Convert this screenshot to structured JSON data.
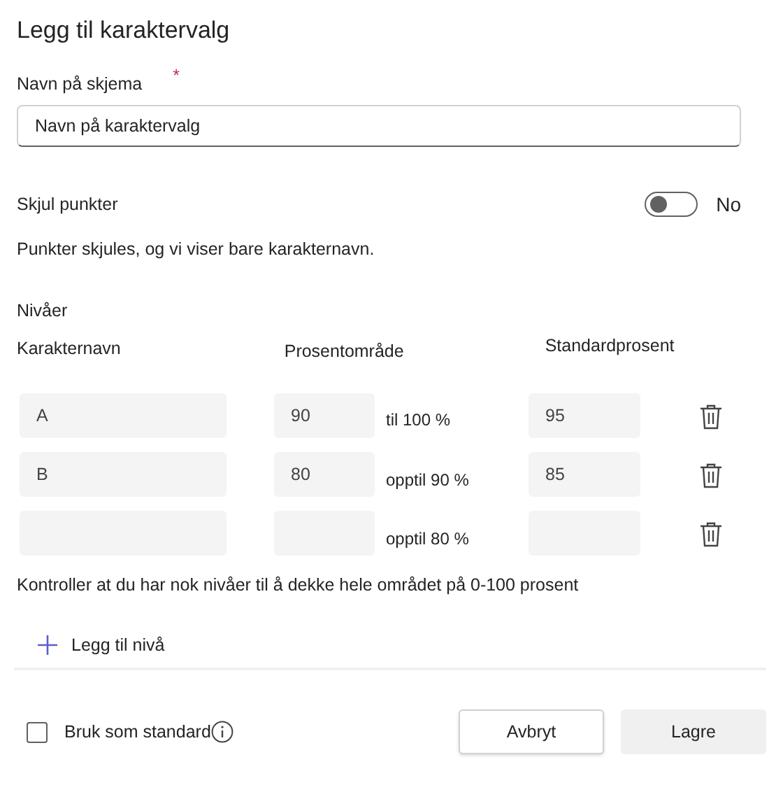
{
  "title": "Legg til karaktervalg",
  "schema_name": {
    "label": "Navn på skjema",
    "required_mark": "*",
    "value": "Navn på karaktervalg"
  },
  "hide_points": {
    "label": "Skjul punkter",
    "on": false,
    "state_text": "No",
    "description": "Punkter skjules, og vi viser bare karakternavn."
  },
  "levels": {
    "heading": "Nivåer",
    "columns": [
      "Karakternavn",
      "Prosentområde",
      "Standardprosent"
    ],
    "rows": [
      {
        "name": "A",
        "from": "90",
        "range_text": "til 100 %",
        "default": "95"
      },
      {
        "name": "B",
        "from": "80",
        "range_text": "opptil 90 %",
        "default": "85"
      },
      {
        "range_text": "opptil 80 %"
      }
    ],
    "note": "Kontroller at du har nok nivåer til å dekke hele området på 0-100 prosent",
    "add_label": "Legg til nivå"
  },
  "footer": {
    "default_checkbox": {
      "label": "Bruk som standard",
      "checked": false
    },
    "buttons": [
      {
        "label": "Avbryt",
        "kind": "secondary"
      },
      {
        "label": "Lagre",
        "kind": "primary"
      }
    ]
  }
}
